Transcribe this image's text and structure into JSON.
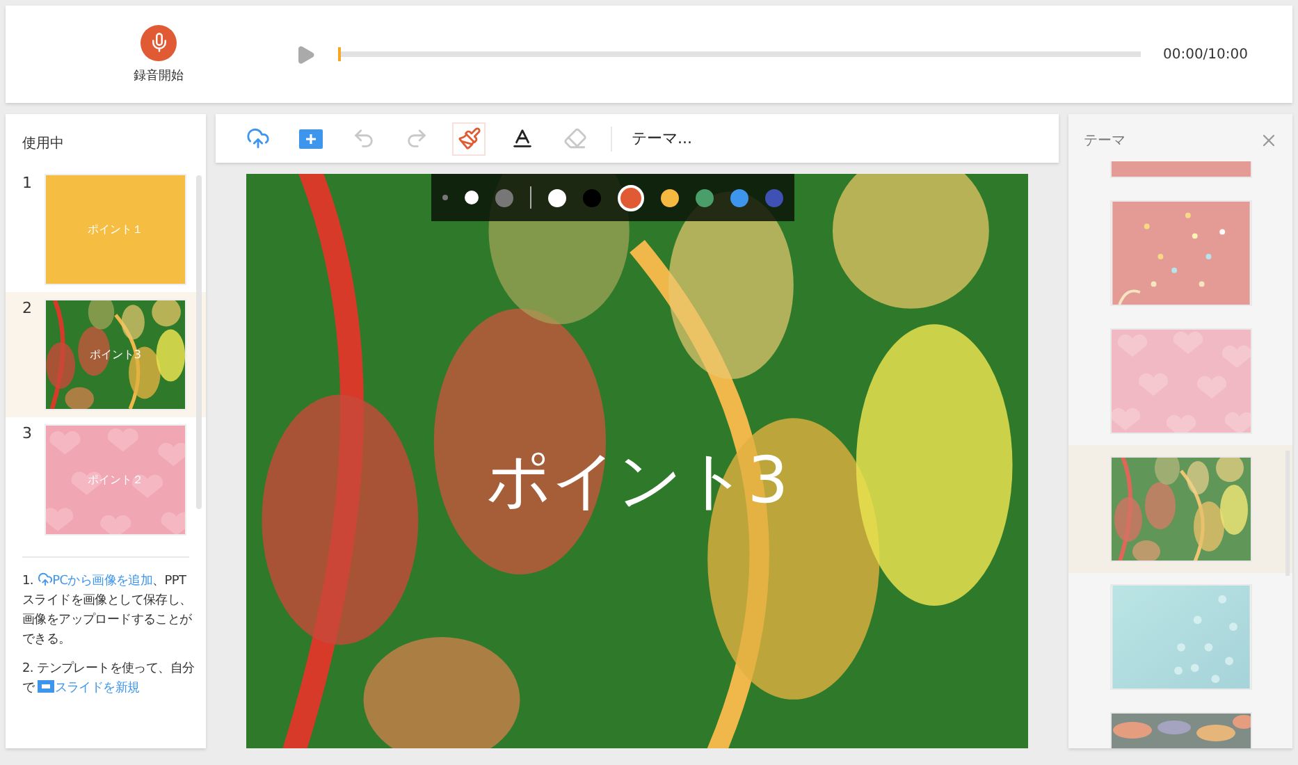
{
  "recorder": {
    "button_label": "録音開始",
    "level": 0,
    "time": "00:00/10:00"
  },
  "slides_panel": {
    "title": "使用中",
    "slides": [
      {
        "number": "1",
        "title": "ポイント１",
        "kind": "plain",
        "color": "#f5be42",
        "selected": false
      },
      {
        "number": "2",
        "title": "ポイント3",
        "kind": "leaves",
        "selected": true
      },
      {
        "number": "3",
        "title": "ポイント２",
        "kind": "hearts",
        "selected": false
      }
    ],
    "help": [
      {
        "number": "1.",
        "kind": "upload_link",
        "link": "PCから画像を追加",
        "text": "、PPTスライドを画像として保存し、画像をアップロードすることができる。"
      },
      {
        "number": "2.",
        "text": "テンプレートを使って、自分で",
        "kind": "slide_link",
        "link": "スライドを新規"
      }
    ]
  },
  "toolbar": {
    "tools": [
      {
        "kind": "upload",
        "selected": false,
        "disabled": false
      },
      {
        "kind": "add",
        "selected": false,
        "disabled": false
      },
      {
        "kind": "undo",
        "selected": false,
        "disabled": true
      },
      {
        "kind": "redo",
        "selected": false,
        "disabled": true
      },
      {
        "kind": "brush",
        "selected": true,
        "disabled": false
      },
      {
        "kind": "text",
        "selected": false,
        "disabled": false
      },
      {
        "kind": "eraser",
        "selected": false,
        "disabled": true
      }
    ],
    "theme_button": "テーマ..."
  },
  "palette": {
    "sizes": [
      {
        "kind": "small",
        "selected": false
      },
      {
        "kind": "medium",
        "selected": true
      },
      {
        "kind": "large",
        "selected": false
      }
    ],
    "colors": [
      {
        "color": "#ffffff",
        "selected": false
      },
      {
        "color": "#000000",
        "selected": false
      },
      {
        "color": "#e05a33",
        "selected": true
      },
      {
        "color": "#f5b942",
        "selected": false
      },
      {
        "color": "#4a9e6a",
        "selected": false
      },
      {
        "color": "#3d95ec",
        "selected": false
      },
      {
        "color": "#3f51b5",
        "selected": false
      }
    ]
  },
  "slide": {
    "kind": "leaves",
    "title": "ポイント3"
  },
  "theme_panel": {
    "title": "テーマ",
    "themes": [
      {
        "kind": "plain",
        "selected": false
      },
      {
        "kind": "confetti",
        "selected": false
      },
      {
        "kind": "hearts",
        "selected": false
      },
      {
        "kind": "leaves",
        "selected": true
      },
      {
        "kind": "bubbles",
        "selected": false
      },
      {
        "kind": "tropical",
        "selected": false
      }
    ]
  }
}
